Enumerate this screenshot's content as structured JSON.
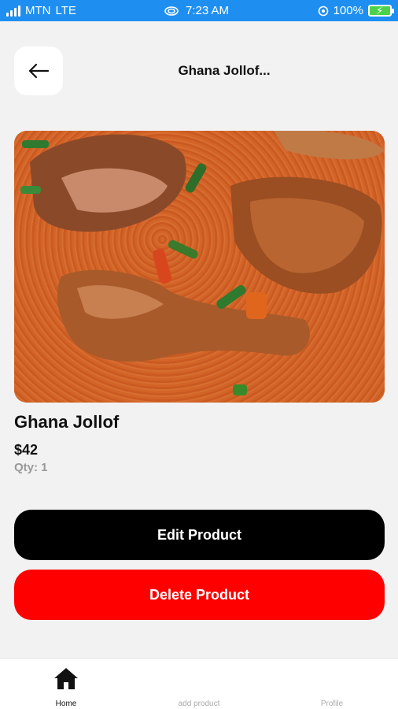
{
  "status_bar": {
    "carrier": "MTN",
    "network": "LTE",
    "time": "7:23 AM",
    "battery": "100%"
  },
  "header": {
    "title": "Ghana Jollof..."
  },
  "product": {
    "image_alt": "Ghana Jollof",
    "name": "Ghana Jollof",
    "price": "$42",
    "qty": "Qty: 1"
  },
  "actions": {
    "edit_label": "Edit Product",
    "delete_label": "Delete Product"
  },
  "bottom_nav": {
    "items": [
      {
        "label": "Home",
        "icon": "home-icon",
        "active": true
      },
      {
        "label": "add product",
        "icon": "add-icon",
        "active": false
      },
      {
        "label": "Profile",
        "icon": "profile-icon",
        "active": false
      }
    ]
  },
  "colors": {
    "status_bar": "#1e8ff0",
    "edit_button": "#000000",
    "delete_button": "#ff0000",
    "background": "#f2f2f2"
  }
}
